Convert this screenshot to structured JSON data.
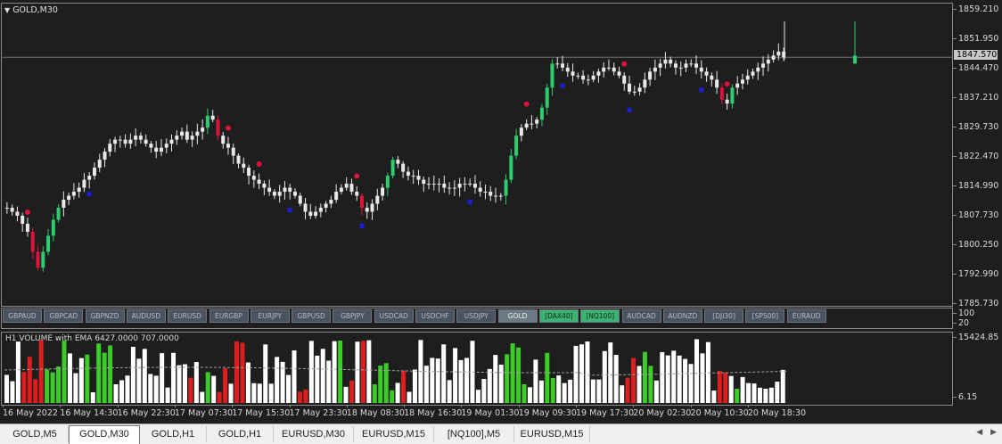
{
  "chart": {
    "title": "GOLD,M30",
    "current_price": "1847.570",
    "price_ticks": [
      "1859.210",
      "1851.950",
      "1844.470",
      "1837.210",
      "1829.730",
      "1822.470",
      "1814.990",
      "1807.730",
      "1800.250",
      "1792.990",
      "1785.730"
    ],
    "mid_ticks": [
      "100",
      "20"
    ],
    "volume_label": "H1 VOLUME with EMA 6427.0000 707.0000",
    "volume_ticks": [
      "15424.85",
      "6.15"
    ],
    "time_ticks": [
      "16 May 2022",
      "16 May 14:30",
      "16 May 22:30",
      "17 May 07:30",
      "17 May 15:30",
      "17 May 23:30",
      "18 May 08:30",
      "18 May 16:30",
      "19 May 01:30",
      "19 May 09:30",
      "19 May 17:30",
      "20 May 02:30",
      "20 May 10:30",
      "20 May 18:30"
    ]
  },
  "symbols": [
    {
      "label": "GBPAUD",
      "state": "normal"
    },
    {
      "label": "GBPCAD",
      "state": "normal"
    },
    {
      "label": "GBPNZD",
      "state": "normal"
    },
    {
      "label": "AUDUSD",
      "state": "normal"
    },
    {
      "label": "EURUSD",
      "state": "normal"
    },
    {
      "label": "EURGBP",
      "state": "normal"
    },
    {
      "label": "EURJPY",
      "state": "normal"
    },
    {
      "label": "GBPUSD",
      "state": "normal"
    },
    {
      "label": "GBPJPY",
      "state": "normal"
    },
    {
      "label": "USDCAD",
      "state": "normal"
    },
    {
      "label": "USDCHF",
      "state": "normal"
    },
    {
      "label": "USDJPY",
      "state": "normal"
    },
    {
      "label": "GOLD",
      "state": "active"
    },
    {
      "label": "[DAX40]",
      "state": "green"
    },
    {
      "label": "[NQ100]",
      "state": "green"
    },
    {
      "label": "AUDCAD",
      "state": "normal"
    },
    {
      "label": "AUDNZD",
      "state": "normal"
    },
    {
      "label": "[DJI30]",
      "state": "normal"
    },
    {
      "label": "[SP500]",
      "state": "normal"
    },
    {
      "label": "EURAUD",
      "state": "normal"
    }
  ],
  "tabs": [
    "GOLD,M5",
    "GOLD,M30",
    "GOLD,H1",
    "GOLD,H1",
    "EURUSD,M30",
    "EURUSD,M15",
    "[NQ100],M5",
    "EURUSD,M15"
  ],
  "active_tab": 1,
  "colors": {
    "bull": "#2ecc71",
    "bear": "#dc143c",
    "neutral": "#e8e8e8",
    "up_dot": "#dc143c",
    "down_dot": "#1c1cdc",
    "vol_green": "#3ccc28",
    "vol_red": "#dc1e1e",
    "vol_white": "#ffffff"
  },
  "chart_data": {
    "type": "candlestick",
    "price_range": [
      1785.73,
      1859.21
    ],
    "closes": [
      1810,
      1809,
      1808,
      1806,
      1804,
      1799,
      1795,
      1799,
      1803,
      1807,
      1810,
      1812,
      1813,
      1814,
      1815,
      1817,
      1818,
      1820,
      1822,
      1824,
      1826,
      1827,
      1827,
      1826,
      1827,
      1828,
      1827,
      1826,
      1825,
      1824,
      1825,
      1826,
      1827,
      1828,
      1829,
      1827,
      1828,
      1829,
      1830,
      1833,
      1832,
      1828,
      1826,
      1825,
      1823,
      1821,
      1820,
      1818,
      1817,
      1816,
      1815,
      1814,
      1813,
      1814,
      1815,
      1814,
      1813,
      1811,
      1809,
      1808,
      1809,
      1810,
      1811,
      1812,
      1814,
      1815,
      1816,
      1814,
      1813,
      1810,
      1809,
      1811,
      1813,
      1815,
      1818,
      1822,
      1821,
      1819,
      1818,
      1818,
      1817,
      1816,
      1816,
      1816,
      1816,
      1815,
      1815,
      1815,
      1816,
      1816,
      1816,
      1815,
      1814,
      1814,
      1813,
      1813,
      1813,
      1817,
      1823,
      1828,
      1830,
      1831,
      1831,
      1832,
      1835,
      1840,
      1846,
      1846,
      1845,
      1844,
      1843,
      1843,
      1842,
      1842,
      1843,
      1844,
      1845,
      1845,
      1844,
      1843,
      1841,
      1839,
      1839,
      1840,
      1842,
      1844,
      1845,
      1846,
      1847,
      1846,
      1845,
      1845,
      1846,
      1846,
      1845,
      1844,
      1843,
      1842,
      1840,
      1837,
      1836,
      1840,
      1841,
      1842,
      1843,
      1844,
      1845,
      1846,
      1847,
      1848,
      1849,
      1847.57
    ],
    "up_arrows_index": [
      4,
      42,
      48,
      67,
      100,
      118,
      138
    ],
    "down_arrows_index": [
      16,
      54,
      68,
      89,
      107,
      119,
      133
    ],
    "volume_ema": [
      6427.0,
      707.0
    ]
  }
}
